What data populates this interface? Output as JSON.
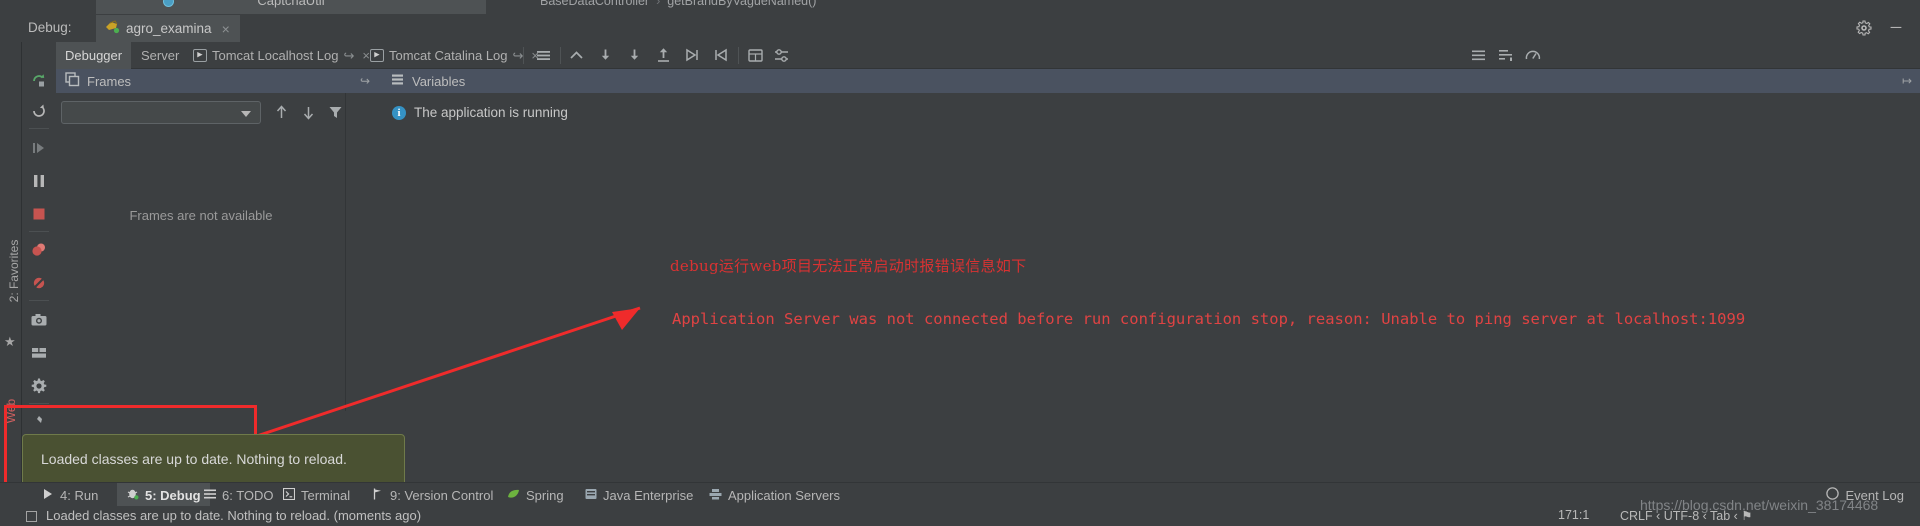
{
  "editor": {
    "tab_title": "CaptchaUtil",
    "tab_icon": "class-icon",
    "breadcrumb_class": "BaseDataController",
    "breadcrumb_sep": "›",
    "breadcrumb_method": "getBrandByVagueNamed()"
  },
  "debug_window": {
    "label": "Debug:",
    "run_config_name": "agro_examina",
    "run_config_icon": "tomcat-icon",
    "close_label": "×",
    "settings_icon": "gear-icon",
    "minimize_icon": "minimize-icon",
    "minimize_label": "─"
  },
  "left_strip": {
    "favorites_label": "2: Favorites",
    "favorites_num": "2",
    "star_icon": "star-icon",
    "web_label": "Web"
  },
  "debug_controls": [
    {
      "name": "rerun-button",
      "icon": "rerun-icon",
      "tooltip": "Rerun"
    },
    {
      "name": "restart-button",
      "icon": "restart-icon",
      "tooltip": "Restart"
    },
    {
      "name": "resume-button",
      "icon": "resume-program-icon",
      "tooltip": "Resume Program"
    },
    {
      "name": "pause-button",
      "icon": "pause-program-icon",
      "tooltip": "Pause Program"
    },
    {
      "name": "stop-button",
      "icon": "stop-icon",
      "tooltip": "Stop"
    },
    {
      "name": "view-breakpoints-button",
      "icon": "breakpoints-icon",
      "tooltip": "View Breakpoints"
    },
    {
      "name": "mute-breakpoints-button",
      "icon": "mute-breakpoints-icon",
      "tooltip": "Mute Breakpoints"
    },
    {
      "name": "screenshot-button",
      "icon": "camera-icon",
      "tooltip": "Take Screenshot"
    },
    {
      "name": "layout-button",
      "icon": "layout-icon",
      "tooltip": "Layout"
    },
    {
      "name": "settings-button",
      "icon": "gear-icon",
      "tooltip": "Settings"
    },
    {
      "name": "pin-button",
      "icon": "pin-icon",
      "tooltip": "Pin Tab"
    }
  ],
  "tabs": [
    {
      "label": "Debugger",
      "selected": true,
      "icon": null
    },
    {
      "label": "Server",
      "selected": false,
      "icon": null
    },
    {
      "label": "Tomcat Localhost Log",
      "selected": false,
      "icon": "console-icon",
      "detach": true,
      "close": "×"
    },
    {
      "label": "Tomcat Catalina Log",
      "selected": false,
      "icon": "console-icon",
      "detach": true,
      "close": "×"
    }
  ],
  "tab_toolbar": [
    {
      "name": "console-toggle-icon",
      "icon": "lines-icon"
    },
    {
      "name": "step-out-icon",
      "icon": "step-out-arrow"
    },
    {
      "name": "step-over-icon",
      "icon": "step-over-arrow"
    },
    {
      "name": "step-into-icon",
      "icon": "step-into-arrow"
    },
    {
      "name": "force-step-into-icon",
      "icon": "force-step-into-arrow"
    },
    {
      "name": "run-to-cursor-icon",
      "icon": "run-to-cursor-arrow"
    },
    {
      "name": "evaluate-expression-icon",
      "icon": "calculator-icon"
    },
    {
      "name": "settings-icon",
      "icon": "sliders-icon"
    }
  ],
  "tab_toolbar_right": [
    {
      "name": "soft-wrap-icon",
      "icon": "wrap-icon"
    },
    {
      "name": "scroll-to-end-icon",
      "icon": "scroll-end-icon"
    },
    {
      "name": "print-icon",
      "icon": "gauge-icon"
    }
  ],
  "frames_panel": {
    "title": "Frames",
    "title_icon": "frames-icon",
    "thread_selector_value": "",
    "empty_text": "Frames are not available",
    "buttons": [
      {
        "name": "frame-up-button",
        "icon": "arrow-up-icon"
      },
      {
        "name": "frame-down-button",
        "icon": "arrow-down-icon"
      },
      {
        "name": "filter-frames-button",
        "icon": "filter-icon"
      },
      {
        "name": "add-watch-button",
        "icon": "plus-icon"
      }
    ]
  },
  "variables_panel": {
    "title": "Variables",
    "title_icon": "variables-icon",
    "detach_icon": "detach-icon",
    "running_message": "The application is running",
    "info_icon": "info-icon",
    "info_glyph": "i",
    "gutter_buttons": [
      {
        "name": "collapse-button",
        "icon": "minus-icon",
        "glyph": "−"
      },
      {
        "name": "scroll-up-button",
        "icon": "triangle-up-icon"
      },
      {
        "name": "scroll-down-button",
        "icon": "triangle-down-icon"
      },
      {
        "name": "copy-button",
        "icon": "copy-icon"
      },
      {
        "name": "link-button",
        "icon": "chain-link-icon"
      }
    ]
  },
  "annotations": {
    "chinese_note": "debug运行web项目无法正常启动时报错误信息如下",
    "error_text": "Application Server was not connected before run configuration stop, reason: Unable to ping server at localhost:1099",
    "arrow_icon": "red-arrow-icon",
    "highlight_icon": "red-rectangle-highlight",
    "accent_color": "#ef2b2b"
  },
  "balloon": {
    "text": "Loaded classes are up to date. Nothing to reload."
  },
  "bottom_bar": {
    "buttons": [
      {
        "label": "4: Run",
        "num": "4",
        "rest": ": Run",
        "icon": "run-icon",
        "selected": false
      },
      {
        "label": "5: Debug",
        "num": "5",
        "rest": ": Debug",
        "icon": "debug-bug-icon",
        "selected": true
      },
      {
        "label": "6: TODO",
        "num": "6",
        "rest": ": TODO",
        "icon": "todo-icon",
        "selected": false
      },
      {
        "label": "Terminal",
        "num": "",
        "rest": "Terminal",
        "icon": "terminal-icon",
        "selected": false
      },
      {
        "label": "9: Version Control",
        "num": "9",
        "rest": ": Version Control",
        "icon": "branch-icon",
        "selected": false
      },
      {
        "label": "Spring",
        "num": "",
        "rest": "Spring",
        "icon": "spring-leaf-icon",
        "selected": false
      },
      {
        "label": "Java Enterprise",
        "num": "",
        "rest": "Java Enterprise",
        "icon": "java-ee-icon",
        "selected": false
      },
      {
        "label": "Application Servers",
        "num": "",
        "rest": "Application Servers",
        "icon": "app-servers-icon",
        "selected": false
      }
    ],
    "event_log": "Event Log",
    "event_log_icon": "event-log-icon"
  },
  "status_bar": {
    "message": "Loaded classes are up to date. Nothing to reload. (moments ago)",
    "checkbox_icon": "checkbox-icon",
    "caret_position": "171:1",
    "line_separator": "CRLF ‹ UTF-8 ‹ Tab ‹ ⚑",
    "watermark": "https://blog.csdn.net/weixin_38174468"
  }
}
